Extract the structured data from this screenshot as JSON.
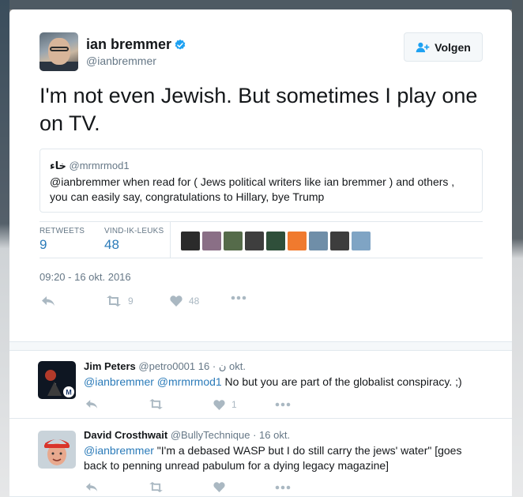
{
  "tweet": {
    "author_name": "ian bremmer",
    "author_handle": "@ianbremmer",
    "follow_label": "Volgen",
    "text": "I'm not even Jewish. But sometimes I play one on TV.",
    "quote": {
      "name": "خاء",
      "handle": "@mrmrmod1",
      "text": "@ianbremmer when read for ( Jews political writers like ian bremmer ) and others , you can easily say, congratulations to Hillary, bye Trump"
    },
    "stats": {
      "retweets_label": "RETWEETS",
      "retweets_value": "9",
      "likes_label": "VIND-IK-LEUKS",
      "likes_value": "48"
    },
    "timestamp": "09:20 - 16 okt. 2016",
    "actions": {
      "retweet_count": "9",
      "like_count": "48"
    }
  },
  "likers": [
    {
      "icon": "hourglass-avatar",
      "color": "#2b2b2b"
    },
    {
      "icon": "portrait-avatar",
      "color": "#8a6f86"
    },
    {
      "icon": "camo-avatar",
      "color": "#556b4a"
    },
    {
      "icon": "bw-portrait-avatar",
      "color": "#3e3e3e"
    },
    {
      "icon": "green-figure-avatar",
      "color": "#2f4f3a"
    },
    {
      "icon": "orange-egg-avatar",
      "color": "#f07a2e"
    },
    {
      "icon": "landscape-avatar",
      "color": "#6f8ea8"
    },
    {
      "icon": "group-avatar",
      "color": "#3d3d3d"
    },
    {
      "icon": "coast-avatar",
      "color": "#7fa4c4"
    }
  ],
  "replies": [
    {
      "name": "Jim Peters",
      "handle": "@petro0001",
      "handle_suffix": " ن",
      "time": "16 okt.",
      "mentions": "@ianbremmer @mrmrmod1",
      "text": " No but you are part of the globalist conspiracy. ;)",
      "retweet_count": "",
      "like_count": "1"
    },
    {
      "name": "David Crosthwait",
      "handle": "@BullyTechnique",
      "handle_suffix": "",
      "time": "16 okt.",
      "mentions": "@ianbremmer",
      "text": " \"I'm a debased WASP but I do still carry the jews' water\" [goes back to penning unread pabulum for a dying legacy magazine]",
      "retweet_count": "",
      "like_count": ""
    }
  ],
  "colors": {
    "link": "#2b7bb9",
    "muted": "#657786",
    "icon": "#aab8c2",
    "verified": "#1da1f2"
  }
}
